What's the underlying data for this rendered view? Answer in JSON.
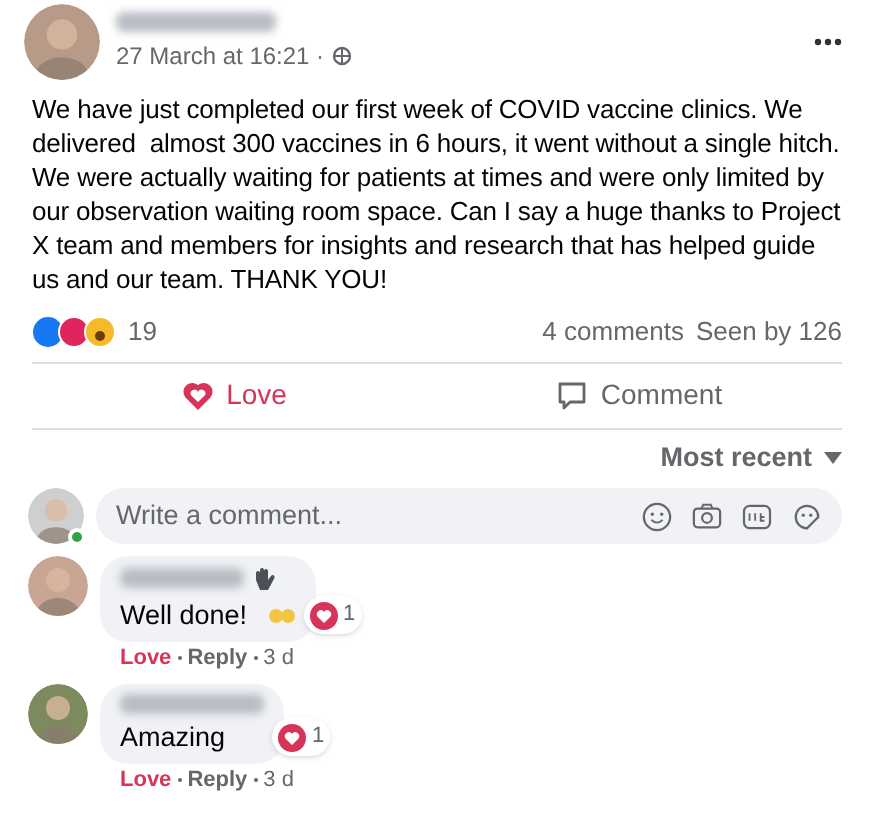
{
  "post": {
    "timestamp": "27 March at 16:21 ·",
    "text": "We have just completed our first week of COVID vaccine clinics. We delivered  almost 300 vaccines in 6 hours, it went without a single hitch. We were actually waiting for patients at times and were only limited by our observation waiting room space. Can I say a huge thanks to Project X team and members for insights and research that has helped guide us and our team. THANK YOU!",
    "reaction_count": "19",
    "comment_count": "4 comments",
    "seen_by": "Seen by 126"
  },
  "actions": [
    {
      "kind": "love",
      "label": "Love",
      "selected": true
    },
    {
      "kind": "comment",
      "label": "Comment",
      "selected": false
    }
  ],
  "sort": {
    "label": "Most recent"
  },
  "composer": {
    "placeholder": "Write a comment...",
    "online": true
  },
  "comments": [
    {
      "text": "Well done!",
      "name_badge": true,
      "trailing_emoji": true,
      "reaction_count": "1",
      "love": {
        "label": "Love",
        "selected": true
      },
      "reply": "Reply",
      "time": "3 d"
    },
    {
      "text": "Amazing",
      "name_badge": false,
      "trailing_emoji": false,
      "reaction_count": "1",
      "love": {
        "label": "Love",
        "selected": true
      },
      "reply": "Reply",
      "time": "3 d"
    }
  ]
}
